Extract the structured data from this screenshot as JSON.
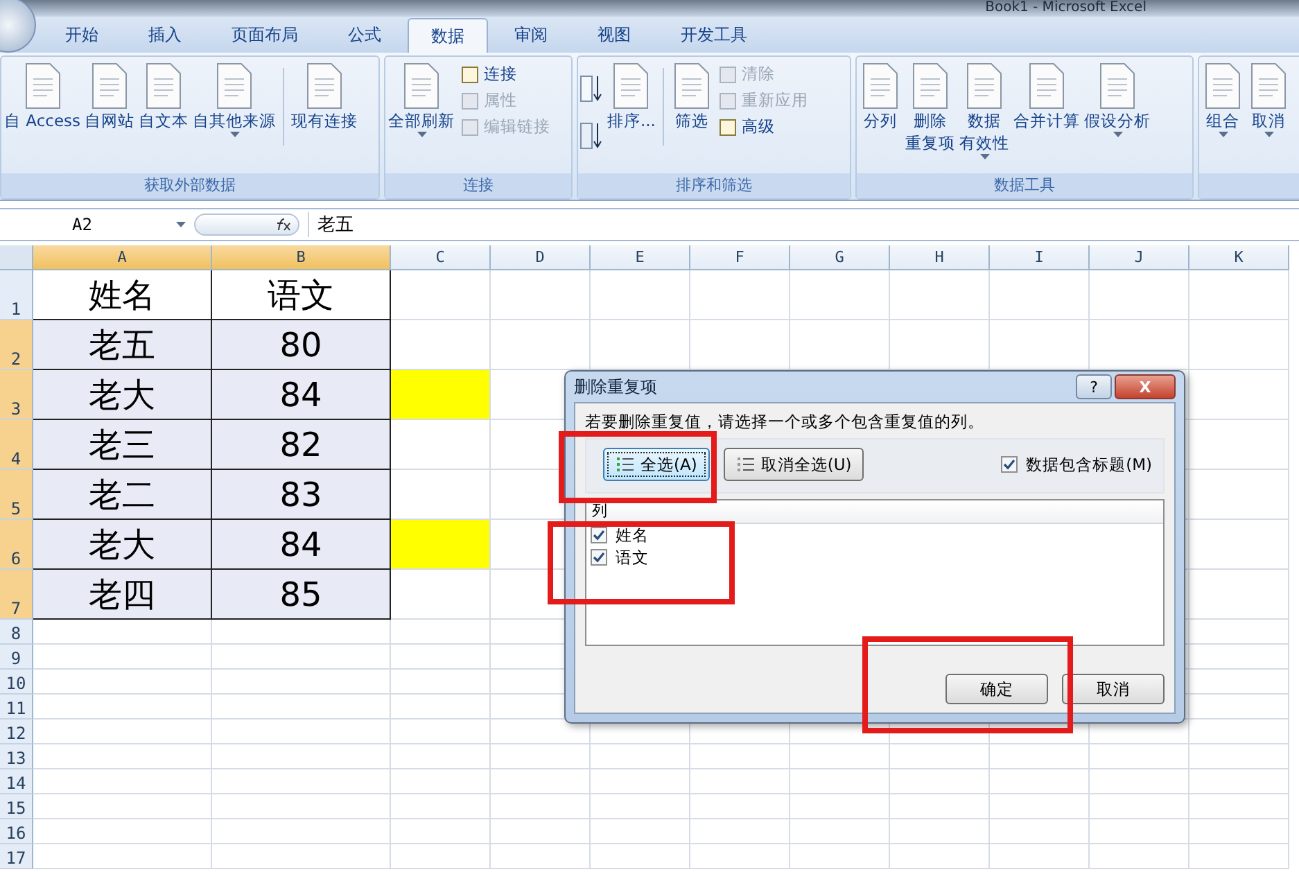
{
  "window": {
    "title": "Book1 - Microsoft Excel"
  },
  "tabs": [
    {
      "label": "开始",
      "selected": false
    },
    {
      "label": "插入",
      "selected": false
    },
    {
      "label": "页面布局",
      "selected": false
    },
    {
      "label": "公式",
      "selected": false
    },
    {
      "label": "数据",
      "selected": true
    },
    {
      "label": "审阅",
      "selected": false
    },
    {
      "label": "视图",
      "selected": false
    },
    {
      "label": "开发工具",
      "selected": false
    }
  ],
  "ribbon_groups": [
    {
      "label": "获取外部数据",
      "buttons": [
        {
          "kind": "large",
          "label": "自 Access",
          "dropdown": false
        },
        {
          "kind": "large",
          "label": "自网站",
          "dropdown": false
        },
        {
          "kind": "large",
          "label": "自文本",
          "dropdown": false
        },
        {
          "kind": "large",
          "label": "自其他来源",
          "dropdown": true
        },
        {
          "kind": "separator"
        },
        {
          "kind": "large",
          "label": "现有连接",
          "dropdown": false
        }
      ]
    },
    {
      "label": "连接",
      "buttons": [
        {
          "kind": "large",
          "label": "全部刷新",
          "dropdown": true
        },
        {
          "kind": "stack",
          "items": [
            {
              "label": "连接",
              "disabled": false
            },
            {
              "label": "属性",
              "disabled": true
            },
            {
              "label": "编辑链接",
              "disabled": true
            }
          ]
        }
      ]
    },
    {
      "label": "排序和筛选",
      "buttons": [
        {
          "kind": "sortpair"
        },
        {
          "kind": "large",
          "label": "排序...",
          "dropdown": false
        },
        {
          "kind": "separator"
        },
        {
          "kind": "large",
          "label": "筛选",
          "dropdown": false
        },
        {
          "kind": "stack",
          "items": [
            {
              "label": "清除",
              "disabled": true
            },
            {
              "label": "重新应用",
              "disabled": true
            },
            {
              "label": "高级",
              "disabled": false
            }
          ]
        }
      ]
    },
    {
      "label": "数据工具",
      "buttons": [
        {
          "kind": "large",
          "label": "分列",
          "dropdown": false
        },
        {
          "kind": "large",
          "label": [
            "删除",
            "重复项"
          ],
          "dropdown": false
        },
        {
          "kind": "large",
          "label": [
            "数据",
            "有效性"
          ],
          "dropdown": true
        },
        {
          "kind": "large",
          "label": "合并计算",
          "dropdown": false
        },
        {
          "kind": "large",
          "label": "假设分析",
          "dropdown": true
        }
      ]
    },
    {
      "buttons": [
        {
          "kind": "large",
          "label": "组合",
          "dropdown": true
        },
        {
          "kind": "large",
          "label": "取消",
          "dropdown": true
        }
      ]
    }
  ],
  "formula_bar": {
    "name_box": "A2",
    "value": "老五"
  },
  "sheet": {
    "columns": [
      {
        "label": "A",
        "selected": true
      },
      {
        "label": "B",
        "selected": true
      },
      {
        "label": "C",
        "selected": false
      },
      {
        "label": "D",
        "selected": false
      },
      {
        "label": "E",
        "selected": false
      },
      {
        "label": "F",
        "selected": false
      },
      {
        "label": "G",
        "selected": false
      },
      {
        "label": "H",
        "selected": false
      },
      {
        "label": "I",
        "selected": false
      },
      {
        "label": "J",
        "selected": false
      },
      {
        "label": "K",
        "selected": false
      }
    ],
    "rows": [
      {
        "header": "1",
        "cells": [
          "姓名",
          "语文"
        ],
        "selected": false,
        "highlight_c": false
      },
      {
        "header": "2",
        "cells": [
          "老五",
          "80"
        ],
        "selected": true,
        "highlight_c": false
      },
      {
        "header": "3",
        "cells": [
          "老大",
          "84"
        ],
        "selected": true,
        "highlight_c": true
      },
      {
        "header": "4",
        "cells": [
          "老三",
          "82"
        ],
        "selected": true,
        "highlight_c": false
      },
      {
        "header": "5",
        "cells": [
          "老二",
          "83"
        ],
        "selected": true,
        "highlight_c": false
      },
      {
        "header": "6",
        "cells": [
          "老大",
          "84"
        ],
        "selected": true,
        "highlight_c": true
      },
      {
        "header": "7",
        "cells": [
          "老四",
          "85"
        ],
        "selected": true,
        "highlight_c": false
      },
      {
        "header": "8",
        "cells": [],
        "selected": false,
        "highlight_c": false
      },
      {
        "header": "9",
        "cells": [],
        "selected": false,
        "highlight_c": false
      },
      {
        "header": "10",
        "cells": [],
        "selected": false,
        "highlight_c": false
      },
      {
        "header": "11",
        "cells": [],
        "selected": false,
        "highlight_c": false
      },
      {
        "header": "12",
        "cells": [],
        "selected": false,
        "highlight_c": false
      },
      {
        "header": "13",
        "cells": [],
        "selected": false,
        "highlight_c": false
      },
      {
        "header": "14",
        "cells": [],
        "selected": false,
        "highlight_c": false
      },
      {
        "header": "15",
        "cells": [],
        "selected": false,
        "highlight_c": false
      },
      {
        "header": "16",
        "cells": [],
        "selected": false,
        "highlight_c": false
      },
      {
        "header": "17",
        "cells": [],
        "selected": false,
        "highlight_c": false
      }
    ]
  },
  "dialog": {
    "title": "删除重复项",
    "help": "?",
    "close": "X",
    "instruction": "若要删除重复值，请选择一个或多个包含重复值的列。",
    "select_all": "全选(A)",
    "unselect_all": "取消全选(U)",
    "has_headers": {
      "label": "数据包含标题(M)",
      "checked": true
    },
    "list_header": "列",
    "columns": [
      {
        "label": "姓名",
        "checked": true
      },
      {
        "label": "语文",
        "checked": true
      }
    ],
    "ok": "确定",
    "cancel": "取消"
  }
}
